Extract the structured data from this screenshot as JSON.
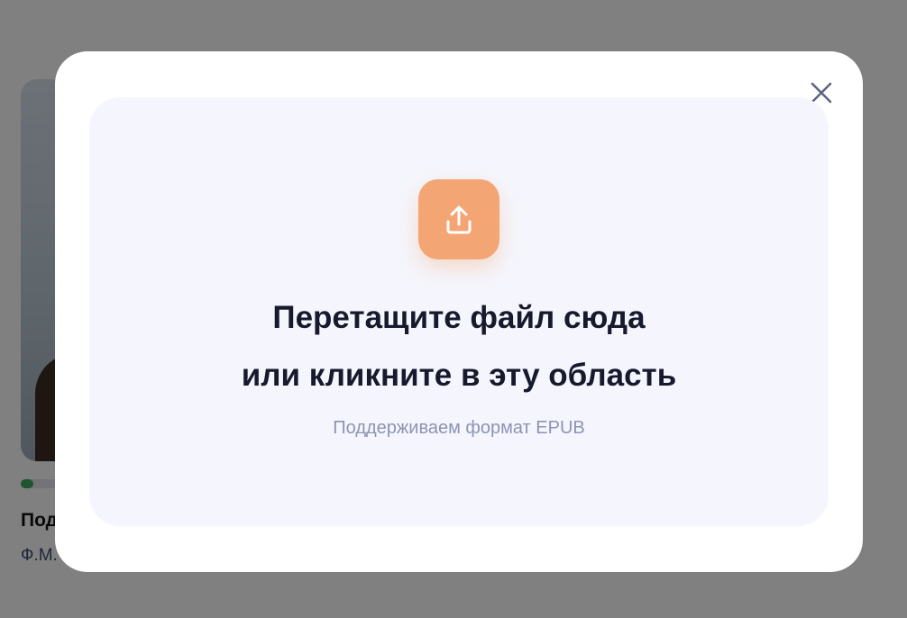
{
  "background": {
    "card": {
      "title": "Под",
      "author": "Ф.М.",
      "progress": 0.12
    }
  },
  "modal": {
    "close_icon": "close-icon",
    "upload_icon": "upload-icon",
    "title_line1": "Перетащите файл сюда",
    "title_line2": "или кликните в эту область",
    "hint": "Поддерживаем формат EPUB",
    "colors": {
      "accent": "#f4a574",
      "dropzone_bg": "#f5f6fd",
      "title": "#171a2c",
      "hint": "#8d93b3"
    }
  }
}
